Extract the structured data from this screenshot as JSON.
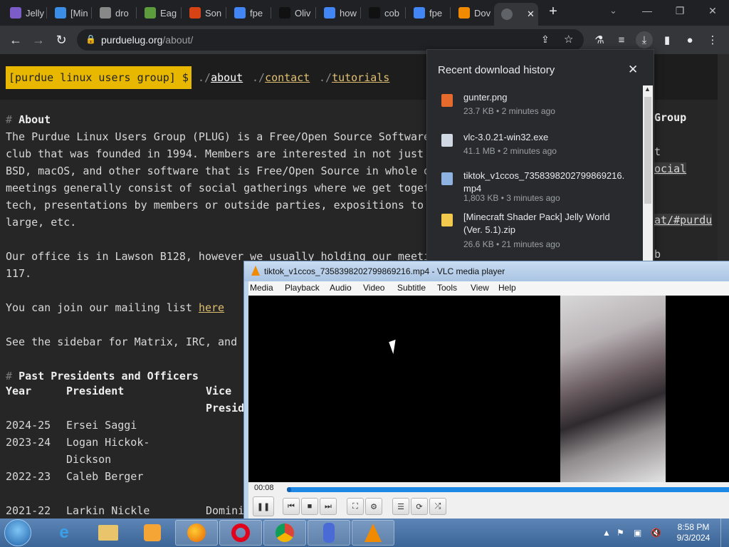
{
  "browser": {
    "tabs": [
      {
        "label": "Jelly",
        "icon": "jellyfin-icon",
        "color": "#7b5cc8"
      },
      {
        "label": "[Min",
        "icon": "minecraft-icon",
        "color": "#3a8ee6"
      },
      {
        "label": "dro",
        "icon": "folder-icon",
        "color": "#888"
      },
      {
        "label": "Eag",
        "icon": "eaglercraft-icon",
        "color": "#5c9c3c"
      },
      {
        "label": "Son",
        "icon": "song-icon",
        "color": "#d84315"
      },
      {
        "label": "fpe",
        "icon": "google-icon",
        "color": "#4285f4"
      },
      {
        "label": "Oliv",
        "icon": "tiktok-icon",
        "color": "#111"
      },
      {
        "label": "how",
        "icon": "google-icon",
        "color": "#4285f4"
      },
      {
        "label": "cob",
        "icon": "cobalt-icon",
        "color": "#111"
      },
      {
        "label": "fpe",
        "icon": "google-icon",
        "color": "#4285f4"
      },
      {
        "label": "Dov",
        "icon": "vlc-icon",
        "color": "#f08a00"
      }
    ],
    "active_tab_close": "✕",
    "new_tab": "+",
    "url_host": "purduelug.org",
    "url_path": "/about/"
  },
  "site": {
    "logo": "[purdue linux users group] $",
    "nav": [
      {
        "prefix": "./",
        "label": "about"
      },
      {
        "prefix": "./",
        "label": "contact"
      },
      {
        "prefix": "./",
        "label": "tutorials"
      }
    ],
    "about_heading": "About",
    "about_lines": [
      "The Purdue Linux Users Group (PLUG) is a Free/Open Source Software",
      "club that was founded in 1994. Members are interested in not just L",
      "BSD, macOS, and other software that is Free/Open Source in whole or",
      "meetings generally consist of social gatherings where we get togeth",
      "tech, presentations by members or outside parties, expositions to t",
      "large, etc."
    ],
    "office_lines": [
      "Our office is in Lawson B128, however we usually holding our meetin",
      "117."
    ],
    "mailing_prefix": "You can join our mailing list ",
    "mailing_link": "here",
    "sidebar_line": "See the sidebar for Matrix, IRC, and G",
    "presidents_heading": "Past Presidents and Officers",
    "table_headers": {
      "year": "Year",
      "president": "President",
      "vice": "Vice",
      "vice2": "Presid"
    },
    "table_rows": [
      {
        "year": "2024-25",
        "president": "Ersei Saggi"
      },
      {
        "year": "2023-24",
        "president": "Logan Hickok-",
        "president2": "Dickson"
      },
      {
        "year": "2022-23",
        "president": "Caleb Berger"
      },
      {
        "year": "2021-22",
        "president": "Larkin Nickle",
        "vice": "Domini"
      }
    ],
    "sidebar_peek": {
      "group": "Group",
      "t": "t",
      "social": "ocial",
      "purdu": "at/#purdu",
      "b": "b"
    }
  },
  "downloads": {
    "title": "Recent download history",
    "items": [
      {
        "name": "gunter.png",
        "meta": "23.7 KB • 2 minutes ago",
        "icon": "image-file-icon",
        "color": "#e56b2c"
      },
      {
        "name": "vlc-3.0.21-win32.exe",
        "meta": "41.1 MB • 2 minutes ago",
        "icon": "exe-file-icon",
        "color": "#cfd8e3"
      },
      {
        "name": "tiktok_v1ccos_7358398202799869216.mp4",
        "meta": "1,803 KB • 3 minutes ago",
        "icon": "video-file-icon",
        "color": "#8fb3e0"
      },
      {
        "name": "[Minecraft Shader Pack] Jelly World (Ver. 5.1).zip",
        "meta": "26.6 KB • 21 minutes ago",
        "icon": "zip-file-icon",
        "color": "#f2c94c"
      }
    ]
  },
  "vlc": {
    "title": "tiktok_v1ccos_7358398202799869216.mp4 - VLC media player",
    "menu": [
      "Media",
      "Playback",
      "Audio",
      "Video",
      "Subtitle",
      "Tools",
      "View",
      "Help"
    ],
    "time": "00:08",
    "progress": 0.01
  },
  "taskbar": {
    "time": "8:58 PM",
    "date": "9/3/2024"
  }
}
